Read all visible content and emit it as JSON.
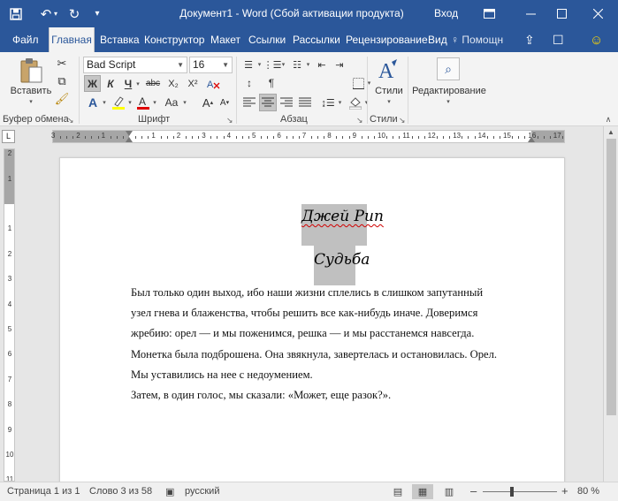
{
  "titlebar": {
    "title": "Документ1  -  Word (Сбой активации продукта)",
    "signin": "Вход",
    "icons": [
      "save-icon",
      "undo-icon",
      "redo-icon",
      "customize-qat-icon",
      "ribbon-display-icon",
      "minimize-icon",
      "maximize-icon",
      "close-icon"
    ]
  },
  "tabs": [
    {
      "label": "Файл"
    },
    {
      "label": "Главная",
      "active": true
    },
    {
      "label": "Вставка"
    },
    {
      "label": "Конструктор"
    },
    {
      "label": "Макет"
    },
    {
      "label": "Ссылки"
    },
    {
      "label": "Рассылки"
    },
    {
      "label": "Рецензирование"
    },
    {
      "label": "Вид"
    }
  ],
  "tell_me": "Помощн",
  "ribbon": {
    "clipboard": {
      "paste_label": "Вставить",
      "group_label": "Буфер обмена"
    },
    "font": {
      "font_name": "Bad Script",
      "font_size": "16",
      "bold": "Ж",
      "italic": "К",
      "underline": "Ч",
      "strike": "abc",
      "subscript": "X₂",
      "superscript": "X²",
      "case": "Aa",
      "grow": "A",
      "shrink": "A",
      "font_color": "A",
      "text_effects": "A",
      "group_label": "Шрифт"
    },
    "paragraph": {
      "group_label": "Абзац"
    },
    "styles": {
      "label": "Стили",
      "group_label": "Стили"
    },
    "editing": {
      "label": "Редактирование"
    }
  },
  "ruler": {
    "corner": "L",
    "h_numbers": [
      "3",
      "2",
      "1",
      "1",
      "2",
      "3",
      "4",
      "5",
      "6",
      "7",
      "8",
      "9",
      "10",
      "11",
      "12",
      "13",
      "14",
      "15",
      "16",
      "17"
    ],
    "v_numbers": [
      "2",
      "1",
      "1",
      "2",
      "3",
      "4",
      "5",
      "6",
      "7",
      "8",
      "9",
      "10",
      "11"
    ]
  },
  "document": {
    "heading1": "Джей Рип",
    "heading2": "Судьба",
    "lines": [
      "Был только один выход, ибо наши жизни сплелись в слишком запутанный",
      "узел гнева и блаженства, чтобы решить все как-нибудь иначе. Доверимся",
      "жребию: орел — и мы поженимся, решка — и мы расстанемся навсегда.",
      "Монетка была подброшена. Она звякнула, завертелась и остановилась. Орел.",
      "Мы уставились на нее с недоумением.",
      "Затем, в один голос, мы сказали: «Может, еще разок?»."
    ]
  },
  "status": {
    "page": "Страница 1 из 1",
    "words": "Слово 3 из 58",
    "language": "русский",
    "zoom": "80 %",
    "zoom_minus": "–",
    "zoom_plus": "+"
  },
  "colors": {
    "titlebar": "#2b579a",
    "ribbon": "#f3f3f3",
    "highlight": "#c0c0c0",
    "spell_underline": "#d00000"
  }
}
